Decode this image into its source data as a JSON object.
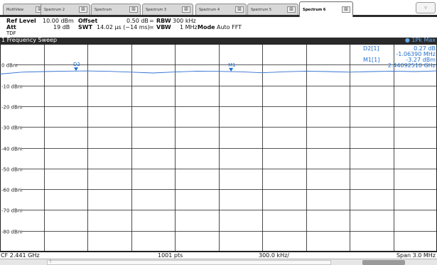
{
  "tabs": [
    {
      "label": "MultiView",
      "active": false
    },
    {
      "label": "Spectrum 2",
      "active": false
    },
    {
      "label": "Spectrum",
      "active": false
    },
    {
      "label": "Spectrum 3",
      "active": false
    },
    {
      "label": "Spectrum 4",
      "active": false
    },
    {
      "label": "Spectrum 5",
      "active": false
    },
    {
      "label": "Spectrum 6",
      "active": true
    }
  ],
  "tab_close_glyph": "⊠",
  "dropdown_glyph": "▿",
  "settings": {
    "ref_level_label": "Ref Level",
    "ref_level_value": "10.00 dBm",
    "offset_label": "Offset",
    "offset_value": "0.50 dB",
    "rbw_label": "RBW",
    "rbw_value": "300 kHz",
    "att_label": "Att",
    "att_value": "19 dB",
    "swt_label": "SWT",
    "swt_value": "14.02 µs (~14 ms)",
    "vbw_label": "VBW",
    "vbw_value": "1 MHz",
    "mode_label": "Mode",
    "mode_value": "Auto FFT",
    "tdf": "TDF",
    "eq": "="
  },
  "window": {
    "title": "1 Frequency Sweep",
    "trace_label": "● 1Pk Max"
  },
  "y_axis": {
    "top_dbm": 10,
    "bottom_dbm": -90,
    "labels": [
      "0 dBm",
      "-10 dBm",
      "-20 dBm",
      "-30 dBm",
      "-40 dBm",
      "-50 dBm",
      "-60 dBm",
      "-70 dBm",
      "-80 dBm"
    ]
  },
  "marker_readout": {
    "d2_label": "D2[1]",
    "d2_value1": "0.27 dB",
    "d2_value2": "-1.06390 MHz",
    "m1_label": "M1[1]",
    "m1_value1": "-3.27 dBm",
    "m1_value2": "2.44092510 GHz"
  },
  "markers": [
    {
      "name": "D2",
      "freq_offset_mhz": -0.978,
      "level_dbm": -3.0
    },
    {
      "name": "M1",
      "freq_offset_mhz": 0.086,
      "level_dbm": -3.27
    }
  ],
  "chart_data": {
    "type": "line",
    "x_range_mhz": [
      -1.5,
      1.5
    ],
    "y_range_dbm": [
      -90,
      10
    ],
    "series": [
      {
        "name": "1Pk Max",
        "x": [
          -1.5,
          -1.35,
          -1.2,
          -1.05,
          -0.9,
          -0.75,
          -0.6,
          -0.45,
          -0.3,
          -0.15,
          0.0,
          0.15,
          0.3,
          0.45,
          0.6,
          0.75,
          0.9,
          1.05,
          1.2,
          1.35,
          1.5
        ],
        "y": [
          -4.5,
          -3.6,
          -3.3,
          -3.1,
          -3.0,
          -3.2,
          -3.6,
          -4.0,
          -3.5,
          -3.1,
          -3.2,
          -3.4,
          -3.9,
          -3.4,
          -3.1,
          -3.3,
          -3.6,
          -3.3,
          -3.1,
          -3.3,
          -3.0
        ]
      }
    ],
    "grid": true
  },
  "bottom": {
    "cf": "CF 2.441 GHz",
    "pts": "1001 pts",
    "div": "300.0 kHz/",
    "span": "Span 3.0 MHz"
  },
  "status_grip": "⁞"
}
